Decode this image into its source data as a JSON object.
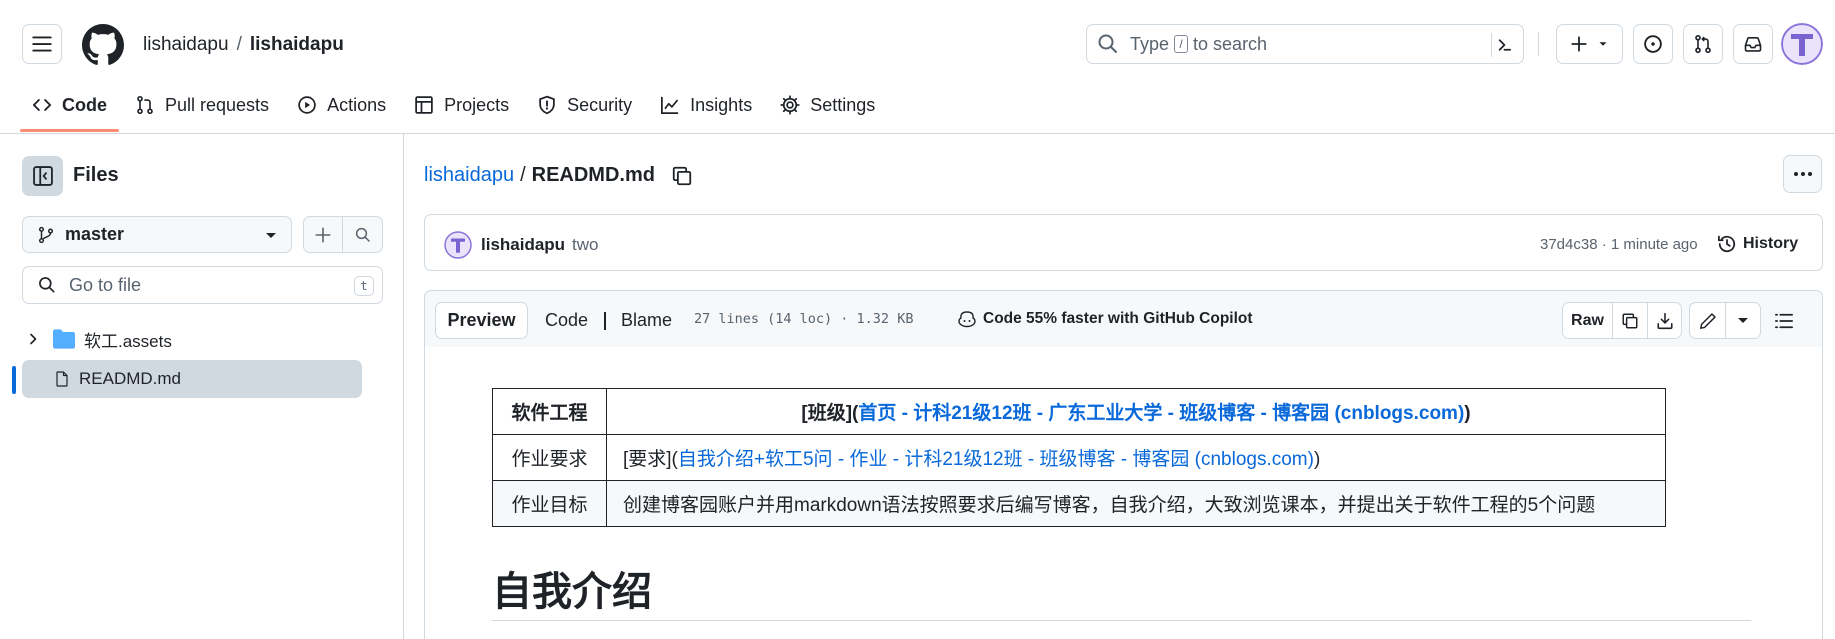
{
  "header": {
    "owner": "lishaidapu",
    "separator": "/",
    "repo": "lishaidapu",
    "search": {
      "before": "Type",
      "key": "/",
      "after": "to search"
    },
    "icons": [
      "hamburger-icon",
      "github-logo-icon",
      "search-icon",
      "command-palette-icon",
      "plus-icon",
      "chevron-down-icon",
      "issues-icon",
      "pull-request-icon",
      "inbox-icon",
      "avatar"
    ]
  },
  "tabs": [
    {
      "label": "Code",
      "icon": "code-icon",
      "selected": true
    },
    {
      "label": "Pull requests",
      "icon": "pull-request-icon"
    },
    {
      "label": "Actions",
      "icon": "play-icon"
    },
    {
      "label": "Projects",
      "icon": "table-icon"
    },
    {
      "label": "Security",
      "icon": "shield-icon"
    },
    {
      "label": "Insights",
      "icon": "graph-icon"
    },
    {
      "label": "Settings",
      "icon": "gear-icon"
    }
  ],
  "sidebar": {
    "title": "Files",
    "branch": "master",
    "goto_placeholder": "Go to file",
    "goto_shortcut": "t",
    "tree": [
      {
        "name": "软工.assets",
        "type": "folder"
      },
      {
        "name": "READMD.md",
        "type": "file",
        "active": true
      }
    ]
  },
  "breadcrumb": {
    "repo": "lishaidapu",
    "separator": "/",
    "file": "READMD.md"
  },
  "commit": {
    "author": "lishaidapu",
    "message": "two",
    "meta": "37d4c38 · 1 minute ago",
    "history_label": "History"
  },
  "file_header": {
    "preview": "Preview",
    "code": "Code",
    "blame": "Blame",
    "loc": "27 lines (14 loc) · 1.32 KB",
    "copilot": "Code 55% faster with GitHub Copilot",
    "raw": "Raw"
  },
  "readme": {
    "table": [
      {
        "key": "软件工程",
        "prefix": "[班级](",
        "link": "首页 - 计科21级12班 - 广东工业大学 - 班级博客 - 博客园 (cnblogs.com)",
        "suffix": ")"
      },
      {
        "key": "作业要求",
        "prefix": "[要求](",
        "link": "自我介绍+软工5问 - 作业 - 计科21级12班 - 班级博客 - 博客园 (cnblogs.com)",
        "suffix": ")"
      },
      {
        "key": "作业目标",
        "text": "创建博客园账户并用markdown语法按照要求后编写博客，自我介绍，大致浏览课本，并提出关于软件工程的5个问题"
      }
    ],
    "heading": "自我介绍"
  },
  "colors": {
    "accent": "#0969da",
    "tab_underline": "#fd8c73",
    "border": "#d1d9e0",
    "muted": "#59636e"
  }
}
